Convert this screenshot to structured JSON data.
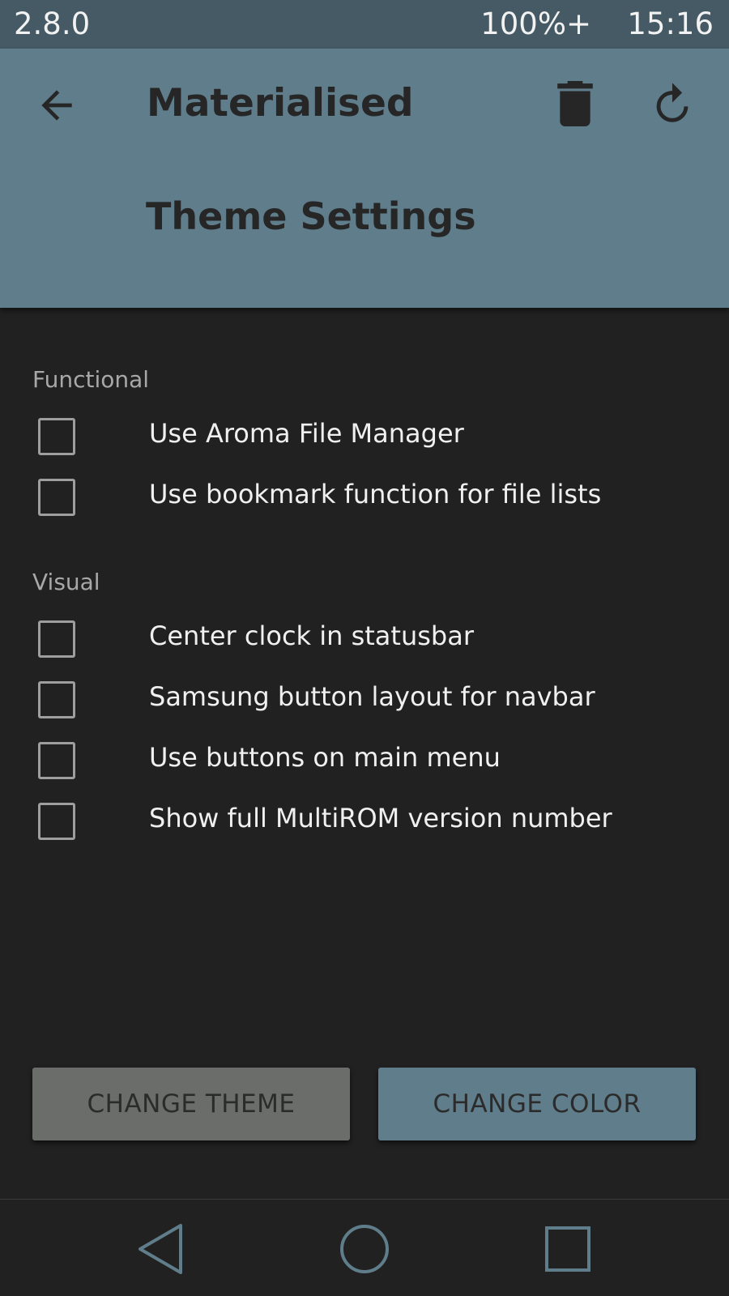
{
  "statusbar": {
    "version": "2.8.0",
    "battery": "100%+",
    "clock": "15:16"
  },
  "header": {
    "title": "Materialised",
    "subtitle": "Theme Settings",
    "icons": {
      "back": "arrow-left-icon",
      "delete": "trash-icon",
      "reset": "refresh-icon"
    }
  },
  "sections": {
    "functional": {
      "label": "Functional",
      "options": [
        {
          "label": "Use Aroma File Manager",
          "checked": false
        },
        {
          "label": "Use bookmark function for file lists",
          "checked": false
        }
      ]
    },
    "visual": {
      "label": "Visual",
      "options": [
        {
          "label": "Center clock in statusbar",
          "checked": false
        },
        {
          "label": "Samsung button layout for navbar",
          "checked": false
        },
        {
          "label": "Use buttons on main menu",
          "checked": false
        },
        {
          "label": "Show full MultiROM version number",
          "checked": false
        }
      ]
    }
  },
  "buttons": {
    "change_theme": "CHANGE THEME",
    "change_color": "CHANGE COLOR"
  },
  "navbar": {
    "icons": [
      "triangle-back-icon",
      "circle-home-icon",
      "square-recents-icon"
    ]
  },
  "colors": {
    "statusbar": "#455a64",
    "header": "#607d8b",
    "background": "#212121",
    "accent": "#607d8b",
    "nav_icon": "#607d8b"
  }
}
